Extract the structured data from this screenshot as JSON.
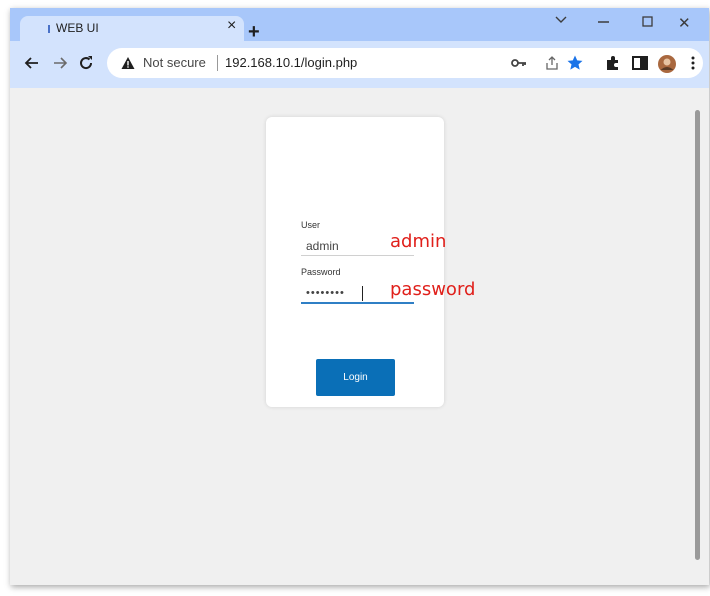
{
  "browser": {
    "tab": {
      "title": "WEB UI",
      "close_glyph": "×"
    },
    "new_tab_glyph": "+",
    "window_controls": {
      "close_glyph": "✕"
    },
    "address_bar": {
      "security_label": "Not secure",
      "url": "192.168.10.1/login.php"
    },
    "colors": {
      "tabstrip": "#a8c7fa",
      "toolbar": "#d3e3fd",
      "bookmark_star": "#1a73e8"
    }
  },
  "login": {
    "user_label": "User",
    "user_value": "admin",
    "password_label": "Password",
    "password_value": "••••••••",
    "login_button": "Login",
    "button_color": "#0a6fb7"
  },
  "annotations": {
    "user_note": "admin",
    "password_note": "password",
    "color": "#e0201b"
  }
}
